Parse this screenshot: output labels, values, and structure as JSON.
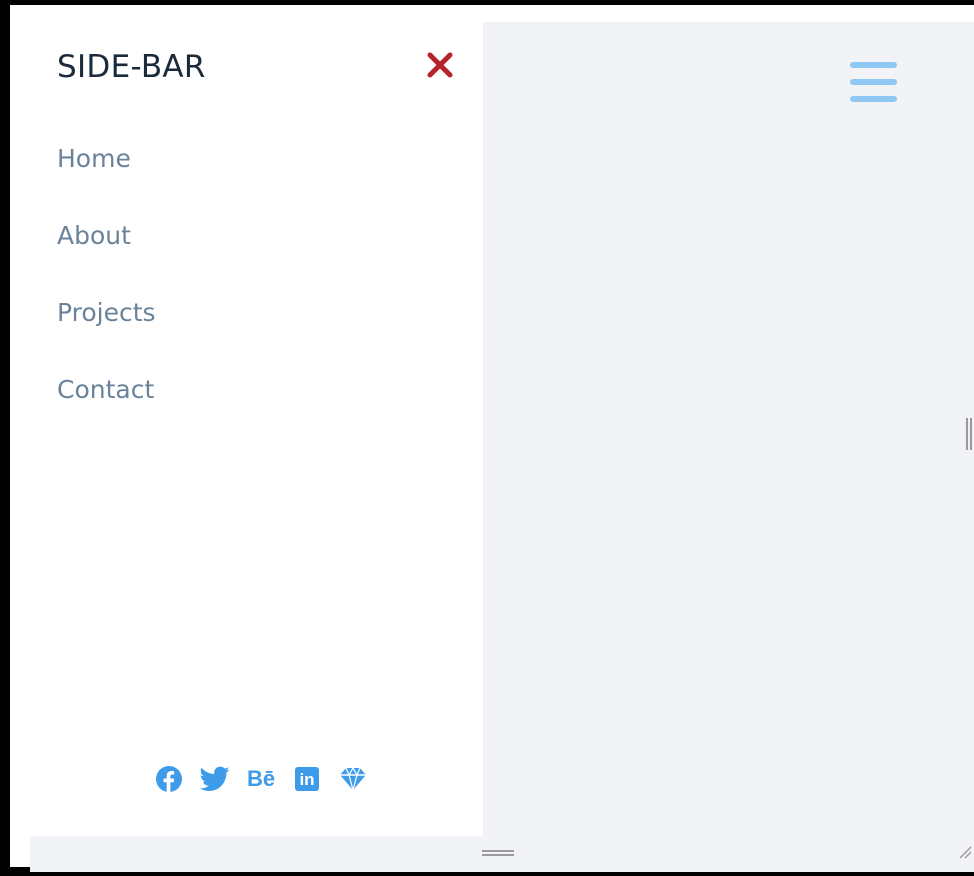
{
  "sidebar": {
    "title": "SIDE-BAR",
    "nav": [
      {
        "label": "Home"
      },
      {
        "label": "About"
      },
      {
        "label": "Projects"
      },
      {
        "label": "Contact"
      }
    ],
    "socials": [
      {
        "icon": "facebook-icon"
      },
      {
        "icon": "twitter-icon"
      },
      {
        "icon": "behance-icon",
        "glyph": "Bē"
      },
      {
        "icon": "linkedin-icon",
        "glyph": "in"
      },
      {
        "icon": "diamond-icon"
      }
    ]
  },
  "colors": {
    "close": "#b5232a",
    "nav_text": "#6b839a",
    "title_text": "#1b2a3a",
    "social": "#3d9be9",
    "hamburger": "#8fc8f5",
    "main_bg": "#f1f3f6",
    "sidebar_bg": "#ffffff"
  }
}
